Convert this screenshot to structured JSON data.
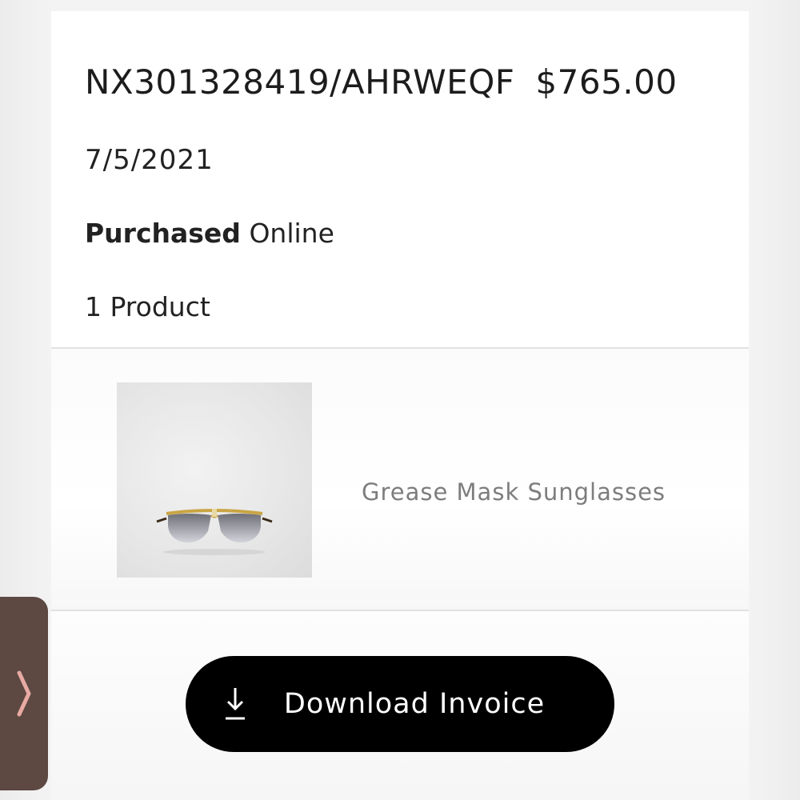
{
  "order": {
    "number": "NX301328419/AHRWEQF",
    "total": "$765.00",
    "date": "7/5/2021",
    "purchase_label": "Purchased",
    "purchase_channel": "Online",
    "product_count": "1 Product"
  },
  "products": [
    {
      "name": "Grease Mask Sunglasses",
      "image": "sunglasses-product-image"
    }
  ],
  "actions": {
    "download_invoice_label": "Download Invoice",
    "download_icon": "download-icon"
  },
  "side_tab": {
    "icon": "chevron-right-icon",
    "color": "#5d4842",
    "icon_color": "#e8aaa3"
  },
  "colors": {
    "button_bg": "#000000",
    "product_name": "#7d7d7d"
  }
}
